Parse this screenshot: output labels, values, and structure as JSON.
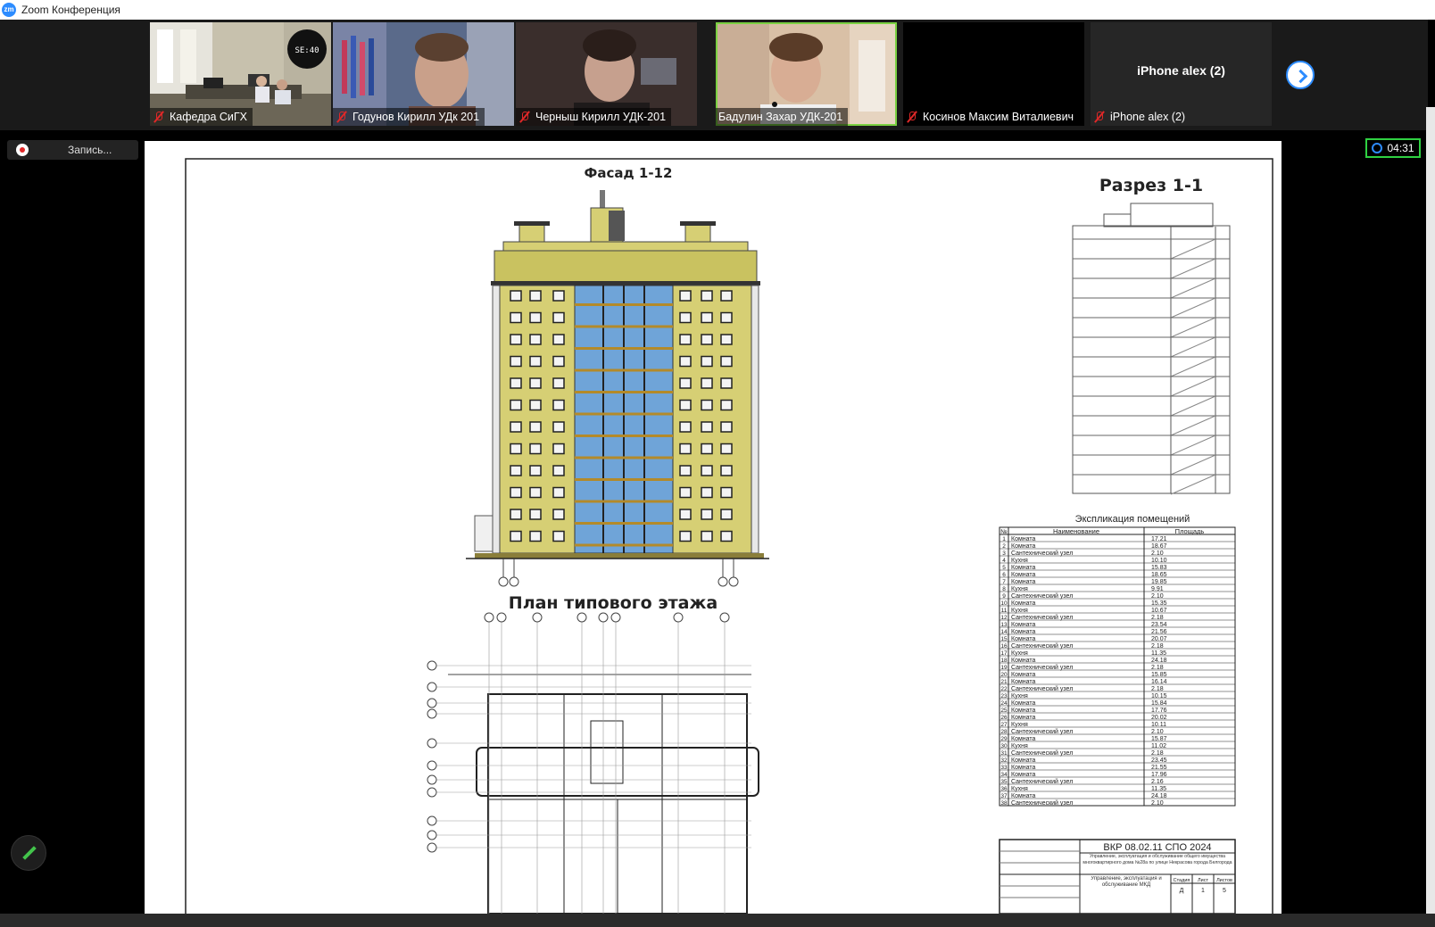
{
  "app": {
    "title": "Zoom Конференция",
    "logo": "zm"
  },
  "participants": [
    {
      "name": "Кафедра СиГХ",
      "muted": true
    },
    {
      "name": "Годунов Кирилл УДк 201",
      "muted": true
    },
    {
      "name": "Черныш Кирилл УДК-201",
      "muted": true
    },
    {
      "name": "Бадулин Захар УДК-201",
      "muted": false,
      "active": true
    },
    {
      "name": "Косинов Максим Виталиевич",
      "muted": true
    },
    {
      "name": "iPhone alex (2)",
      "muted": true,
      "video_off": true,
      "big_label": "iPhone alex (2)"
    }
  ],
  "tile1_clock": "SE:40",
  "recording": {
    "label": "Запись..."
  },
  "timer": {
    "value": "04:31"
  },
  "sheet": {
    "facade_title": "Фасад 1-12",
    "section_title": "Разрез 1-1",
    "plan_title": "План типового этажа",
    "explication_title": "Экспликация помещений",
    "table_headers": [
      "№",
      "Наименование",
      "Площадь"
    ],
    "rooms": [
      [
        "1",
        "Комната",
        "17.21"
      ],
      [
        "2",
        "Комната",
        "18.67"
      ],
      [
        "3",
        "Сантехнический узел",
        "2.10"
      ],
      [
        "4",
        "Кухня",
        "10.10"
      ],
      [
        "5",
        "Комната",
        "15.83"
      ],
      [
        "6",
        "Комната",
        "18.65"
      ],
      [
        "7",
        "Комната",
        "19.85"
      ],
      [
        "8",
        "Кухня",
        "9.91"
      ],
      [
        "9",
        "Сантехнический узел",
        "2.10"
      ],
      [
        "10",
        "Комната",
        "15.35"
      ],
      [
        "11",
        "Кухня",
        "10.67"
      ],
      [
        "12",
        "Сантехнический узел",
        "2.18"
      ],
      [
        "13",
        "Комната",
        "23.54"
      ],
      [
        "14",
        "Комната",
        "21.56"
      ],
      [
        "15",
        "Комната",
        "20.07"
      ],
      [
        "16",
        "Сантехнический узел",
        "2.18"
      ],
      [
        "17",
        "Кухня",
        "11.35"
      ],
      [
        "18",
        "Комната",
        "24.18"
      ],
      [
        "19",
        "Сантехнический узел",
        "2.18"
      ],
      [
        "20",
        "Комната",
        "15.85"
      ],
      [
        "21",
        "Комната",
        "16.14"
      ],
      [
        "22",
        "Сантехнический узел",
        "2.18"
      ],
      [
        "23",
        "Кухня",
        "10.15"
      ],
      [
        "24",
        "Комната",
        "15.84"
      ],
      [
        "25",
        "Комната",
        "17.76"
      ],
      [
        "26",
        "Комната",
        "20.02"
      ],
      [
        "27",
        "Кухня",
        "10.11"
      ],
      [
        "28",
        "Сантехнический узел",
        "2.10"
      ],
      [
        "29",
        "Комната",
        "15.87"
      ],
      [
        "30",
        "Кухня",
        "11.02"
      ],
      [
        "31",
        "Сантехнический узел",
        "2.18"
      ],
      [
        "32",
        "Комната",
        "23.45"
      ],
      [
        "33",
        "Комната",
        "21.55"
      ],
      [
        "34",
        "Комната",
        "17.96"
      ],
      [
        "35",
        "Сантехнический узел",
        "2.16"
      ],
      [
        "36",
        "Кухня",
        "11.35"
      ],
      [
        "37",
        "Комната",
        "24.18"
      ],
      [
        "38",
        "Сантехнический узел",
        "2.10"
      ]
    ],
    "stamp_code": "ВКР 08.02.11 СПО 2024",
    "stamp_desc": "Управление, эксплуатация и обслуживание общего имущества многоквартирного дома №28а по улице Некрасова города Белгорода",
    "stamp_sub": "Управление, эксплуатация и обслуживание МКД",
    "stamp_cols": [
      "Стадия",
      "Лист",
      "Листов"
    ],
    "stamp_vals": [
      "Д",
      "1",
      "5"
    ]
  }
}
